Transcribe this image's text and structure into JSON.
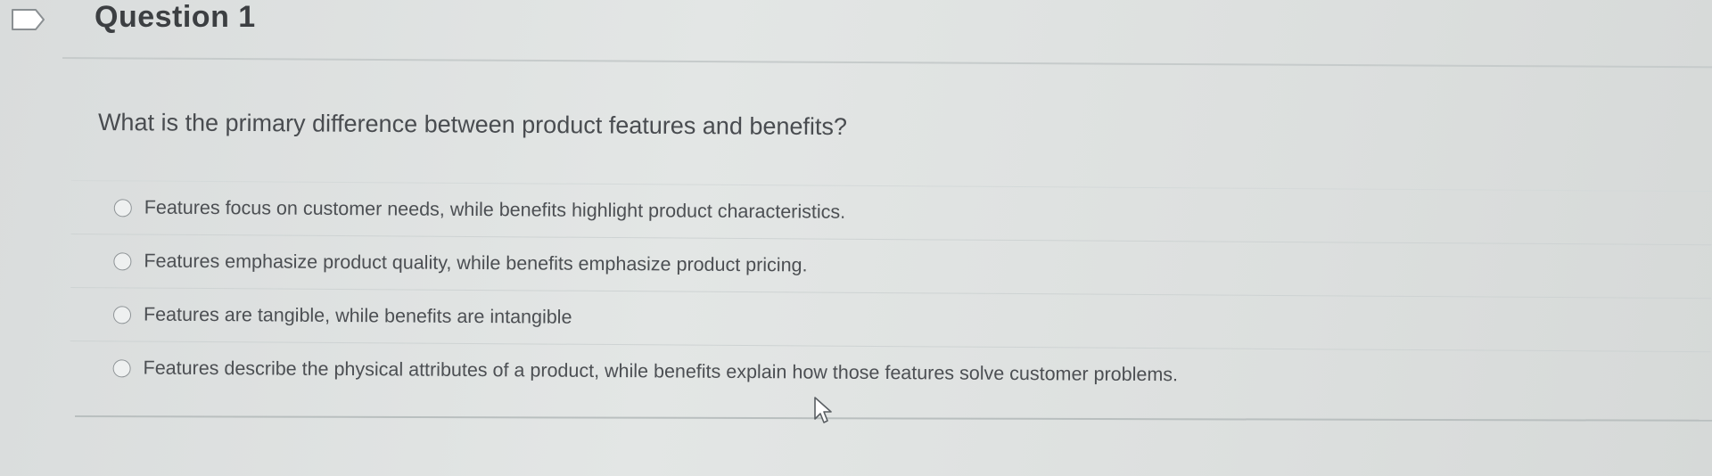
{
  "question": {
    "header": "Question 1",
    "text": "What is the primary difference between product features and benefits?"
  },
  "options": [
    {
      "label": "Features focus on customer needs, while benefits highlight product characteristics.",
      "selected": false
    },
    {
      "label": "Features emphasize product quality, while benefits emphasize product pricing.",
      "selected": false
    },
    {
      "label": "Features are tangible, while benefits are intangible",
      "selected": false
    },
    {
      "label": "Features describe the physical attributes of a product, while benefits explain how those features solve customer problems.",
      "selected": false
    }
  ],
  "icons": {
    "flag": "flag-question-icon",
    "cursor": "mouse-pointer-icon"
  },
  "colors": {
    "background": "#e0e3e2",
    "text": "#4a4d50",
    "radio_border": "#8e9396"
  }
}
